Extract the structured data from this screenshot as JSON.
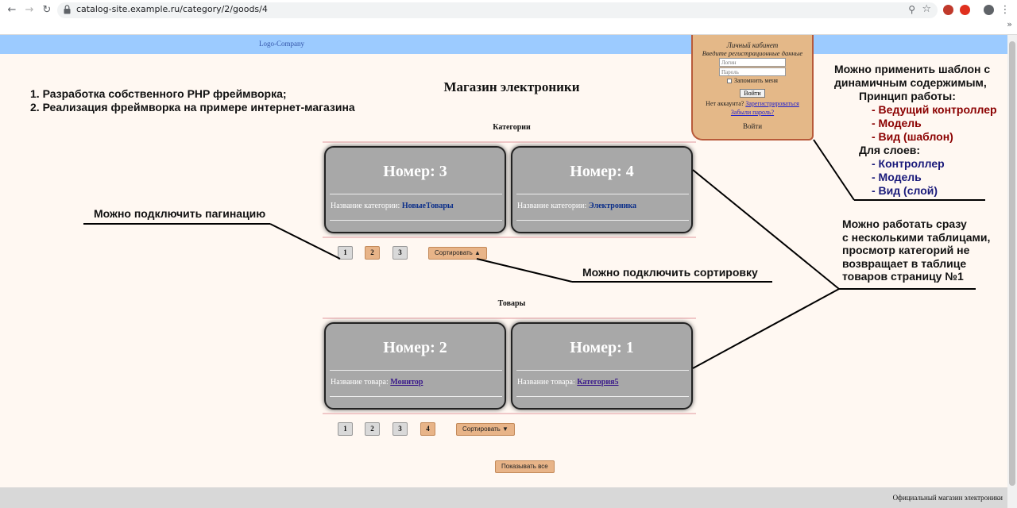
{
  "browser": {
    "url": "catalog-site.example.ru/category/2/goods/4",
    "more_label": "»"
  },
  "header": {
    "logo_alt": "Logo-Company"
  },
  "login": {
    "title": "Личный кабинет",
    "subtitle": "Введите регистрационные данные",
    "login_placeholder": "Логин",
    "password_placeholder": "Пароль",
    "remember_label": "Запомнить меня",
    "submit_label": "Войти",
    "no_account_label": "Нет аккаунта?",
    "register_link": "Зарегистрироваться",
    "forgot_link": "Забыли пароль?",
    "enter_label": "Войти"
  },
  "notes": {
    "line1": "1. Разработка собственного PHP фреймворка;",
    "line2": "2. Реализация фреймворка на примере интернет-магазина"
  },
  "main": {
    "title": "Магазин электроники",
    "categories": {
      "heading": "Категории",
      "cards": [
        {
          "number": "Номер: 3",
          "label": "Название категории:",
          "value": "НовыеТовары"
        },
        {
          "number": "Номер: 4",
          "label": "Название категории:",
          "value": "Электроника"
        }
      ],
      "pages": [
        "1",
        "2",
        "3"
      ],
      "active_page": "2",
      "sort_label": "Сортировать ▲"
    },
    "goods": {
      "heading": "Товары",
      "cards": [
        {
          "number": "Номер: 2",
          "label": "Название товара:",
          "value": "Монитор"
        },
        {
          "number": "Номер: 1",
          "label": "Название товара:",
          "value": "Категория5"
        }
      ],
      "pages": [
        "1",
        "2",
        "3",
        "4"
      ],
      "active_page": "4",
      "sort_label": "Сортировать ▼"
    },
    "show_all_label": "Показывать все"
  },
  "annotations": {
    "pagination": "Можно подключить пагинацию",
    "sorting": "Можно подключить сортировку",
    "template": {
      "l1": "Можно применить шаблон с",
      "l2": "динамичным содержимым,",
      "l3": "Принцип работы:",
      "l4": "- Ведущий контроллер",
      "l5": "- Модель",
      "l6": "- Вид (шаблон)",
      "l7": "Для слоев:",
      "l8": "- Контроллер",
      "l9": "- Модель",
      "l10": "- Вид (слой)"
    },
    "tables": {
      "l1": "Можно работать сразу",
      "l2": "с несколькими таблицами,",
      "l3": "просмотр категорий не",
      "l4": "возвращает в таблице",
      "l5": "товаров страницу №1"
    }
  },
  "footer": {
    "text": "Официальный магазин электроники"
  }
}
